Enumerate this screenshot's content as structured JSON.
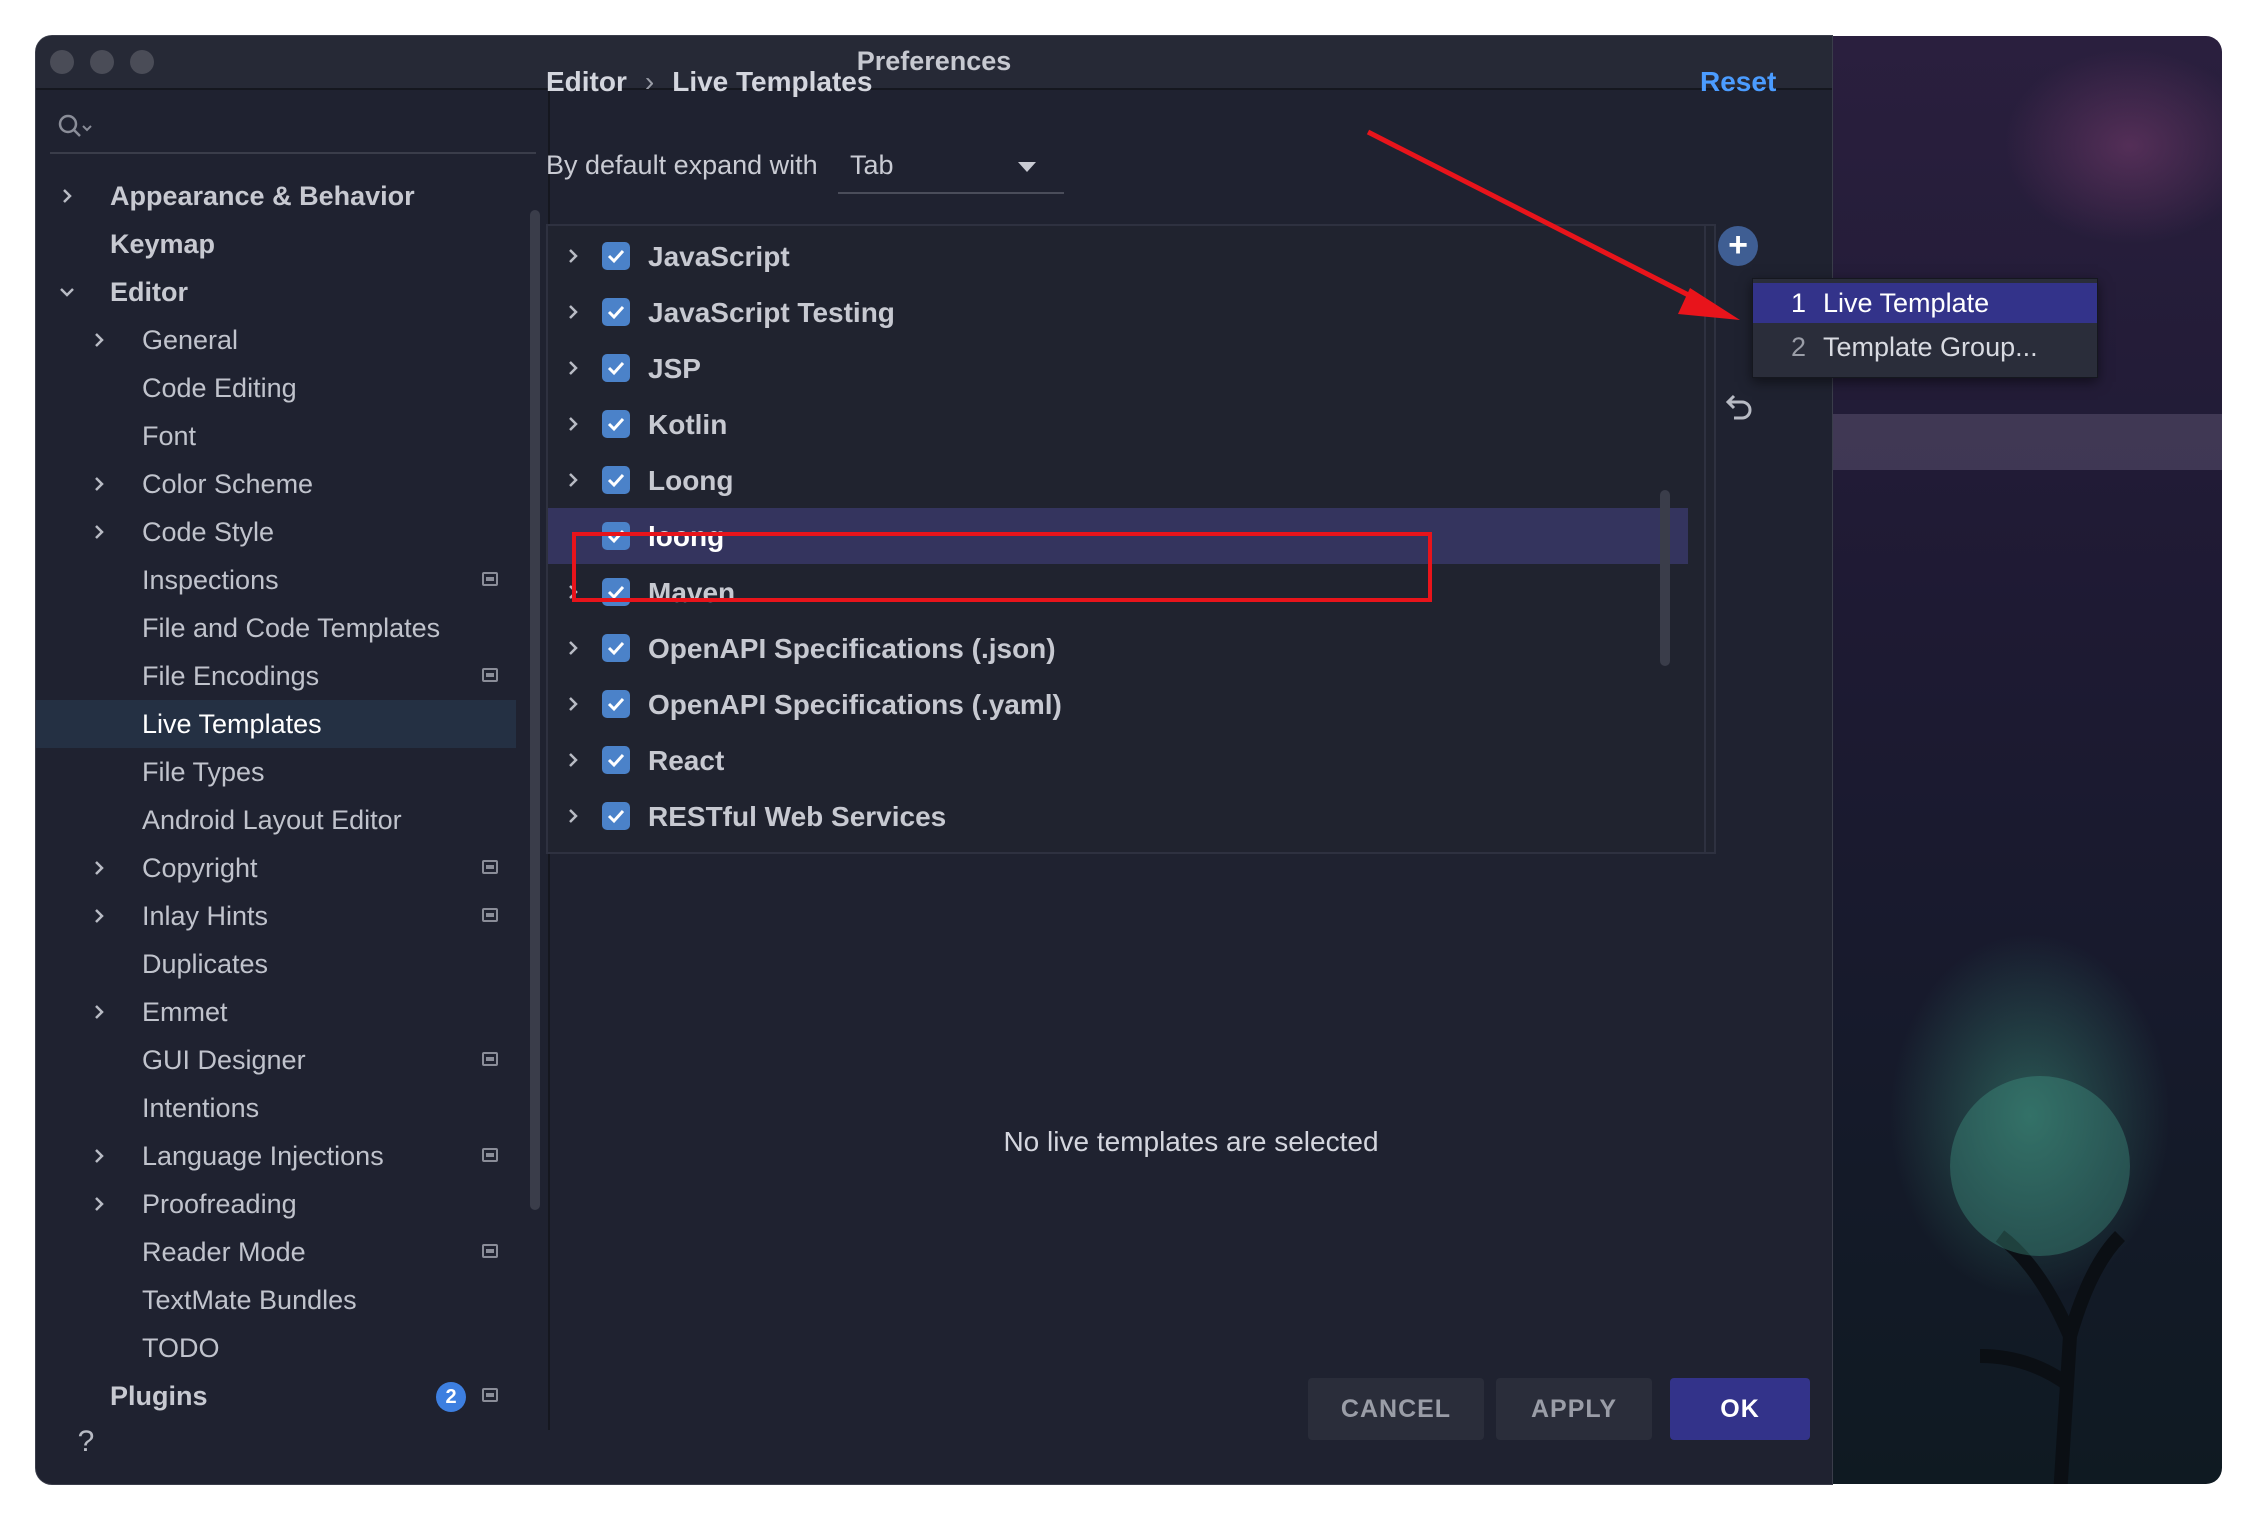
{
  "window": {
    "title": "Preferences"
  },
  "sidebar": {
    "search_placeholder": "",
    "items": [
      {
        "label": "Appearance & Behavior",
        "level": 0,
        "bold": true,
        "chevron": "right"
      },
      {
        "label": "Keymap",
        "level": 0,
        "bold": true,
        "chevron": ""
      },
      {
        "label": "Editor",
        "level": 0,
        "bold": true,
        "chevron": "down"
      },
      {
        "label": "General",
        "level": 1,
        "chevron": "right"
      },
      {
        "label": "Code Editing",
        "level": 1,
        "chevron": ""
      },
      {
        "label": "Font",
        "level": 1,
        "chevron": ""
      },
      {
        "label": "Color Scheme",
        "level": 1,
        "chevron": "right"
      },
      {
        "label": "Code Style",
        "level": 1,
        "chevron": "right"
      },
      {
        "label": "Inspections",
        "level": 1,
        "chevron": "",
        "project_icon": true
      },
      {
        "label": "File and Code Templates",
        "level": 1,
        "chevron": ""
      },
      {
        "label": "File Encodings",
        "level": 1,
        "chevron": "",
        "project_icon": true
      },
      {
        "label": "Live Templates",
        "level": 1,
        "chevron": "",
        "selected": true
      },
      {
        "label": "File Types",
        "level": 1,
        "chevron": ""
      },
      {
        "label": "Android Layout Editor",
        "level": 1,
        "chevron": ""
      },
      {
        "label": "Copyright",
        "level": 1,
        "chevron": "right",
        "project_icon": true
      },
      {
        "label": "Inlay Hints",
        "level": 1,
        "chevron": "right",
        "project_icon": true
      },
      {
        "label": "Duplicates",
        "level": 1,
        "chevron": ""
      },
      {
        "label": "Emmet",
        "level": 1,
        "chevron": "right"
      },
      {
        "label": "GUI Designer",
        "level": 1,
        "chevron": "",
        "project_icon": true
      },
      {
        "label": "Intentions",
        "level": 1,
        "chevron": ""
      },
      {
        "label": "Language Injections",
        "level": 1,
        "chevron": "right",
        "project_icon": true
      },
      {
        "label": "Proofreading",
        "level": 1,
        "chevron": "right"
      },
      {
        "label": "Reader Mode",
        "level": 1,
        "chevron": "",
        "project_icon": true
      },
      {
        "label": "TextMate Bundles",
        "level": 1,
        "chevron": ""
      },
      {
        "label": "TODO",
        "level": 1,
        "chevron": ""
      },
      {
        "label": "Plugins",
        "level": 0,
        "bold": true,
        "chevron": "",
        "badge": "2",
        "project_icon": true
      }
    ],
    "help_label": "?"
  },
  "main": {
    "breadcrumb": {
      "parent": "Editor",
      "separator": "›",
      "current": "Live Templates"
    },
    "reset_label": "Reset",
    "expand": {
      "label": "By default expand with",
      "value": "Tab"
    },
    "groups": [
      {
        "label": "JavaScript",
        "checked": true,
        "chevron": true
      },
      {
        "label": "JavaScript Testing",
        "checked": true,
        "chevron": true
      },
      {
        "label": "JSP",
        "checked": true,
        "chevron": true
      },
      {
        "label": "Kotlin",
        "checked": true,
        "chevron": true
      },
      {
        "label": "Loong",
        "checked": true,
        "chevron": true
      },
      {
        "label": "loong",
        "checked": true,
        "chevron": false,
        "selected": true
      },
      {
        "label": "Maven",
        "checked": true,
        "chevron": true
      },
      {
        "label": "OpenAPI Specifications (.json)",
        "checked": true,
        "chevron": true
      },
      {
        "label": "OpenAPI Specifications (.yaml)",
        "checked": true,
        "chevron": true
      },
      {
        "label": "React",
        "checked": true,
        "chevron": true
      },
      {
        "label": "RESTful Web Services",
        "checked": true,
        "chevron": true
      }
    ],
    "add_label": "+",
    "popup": [
      {
        "num": "1",
        "label": "Live Template",
        "active": true
      },
      {
        "num": "2",
        "label": "Template Group...",
        "active": false
      }
    ],
    "empty_message": "No live templates are selected"
  },
  "buttons": {
    "cancel": "CANCEL",
    "apply": "APPLY",
    "ok": "OK"
  },
  "colors": {
    "accent": "#4b9cff",
    "annotation": "#e8141b",
    "selection": "#33338a"
  }
}
